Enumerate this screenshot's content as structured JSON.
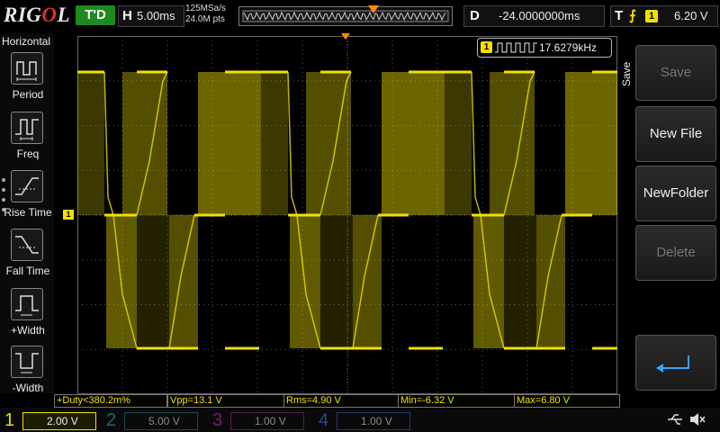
{
  "brand": {
    "part1": "RIG",
    "part2": "O",
    "part3": "L"
  },
  "top": {
    "trigger_state": "T'D",
    "horizontal": {
      "key": "H",
      "value": "5.00ms"
    },
    "sample_rate": "125MSa/s",
    "memory_depth": "24.0M pts",
    "delay": {
      "key": "D",
      "value": "-24.0000000ms"
    },
    "trigger": {
      "key": "T",
      "slope_icon": "rising-edge-icon",
      "channel": "1",
      "level": "6.20 V"
    }
  },
  "left_menu": {
    "title": "Horizontal",
    "items": [
      {
        "label": "Period",
        "icon": "period-icon"
      },
      {
        "label": "Freq",
        "icon": "frequency-icon"
      },
      {
        "label": "Rise Time",
        "icon": "rise-time-icon"
      },
      {
        "label": "Fall Time",
        "icon": "fall-time-icon"
      },
      {
        "label": "+Width",
        "icon": "positive-width-icon"
      },
      {
        "label": "-Width",
        "icon": "negative-width-icon"
      }
    ]
  },
  "screen": {
    "channel_marker": "1",
    "frequency_readout": {
      "channel": "1",
      "value": "17.6279kHz"
    },
    "trace_color": "#f0e000"
  },
  "right_menu": {
    "tab": "Save",
    "buttons": [
      {
        "label": "Save",
        "enabled": false
      },
      {
        "label": "New File",
        "enabled": true
      },
      {
        "label": "NewFolder",
        "enabled": true
      },
      {
        "label": "Delete",
        "enabled": false
      },
      {
        "label": "",
        "icon": "enter-icon",
        "enabled": true
      }
    ]
  },
  "measurements": [
    "+Duty<380.2m%",
    "Vpp=13.1 V",
    "Rms=4.90 V",
    "Min=-6.32 V",
    "Max=6.80 V"
  ],
  "channels": [
    {
      "number": "1",
      "scale": "2.00 V",
      "color": "#f0e000",
      "active": true
    },
    {
      "number": "2",
      "scale": "5.00 V",
      "color": "#00b4b4",
      "active": false
    },
    {
      "number": "3",
      "scale": "1.00 V",
      "color": "#d020d0",
      "active": false
    },
    {
      "number": "4",
      "scale": "1.00 V",
      "color": "#2060e0",
      "active": false
    }
  ],
  "status_icons": [
    "usb-icon",
    "mute-icon"
  ]
}
